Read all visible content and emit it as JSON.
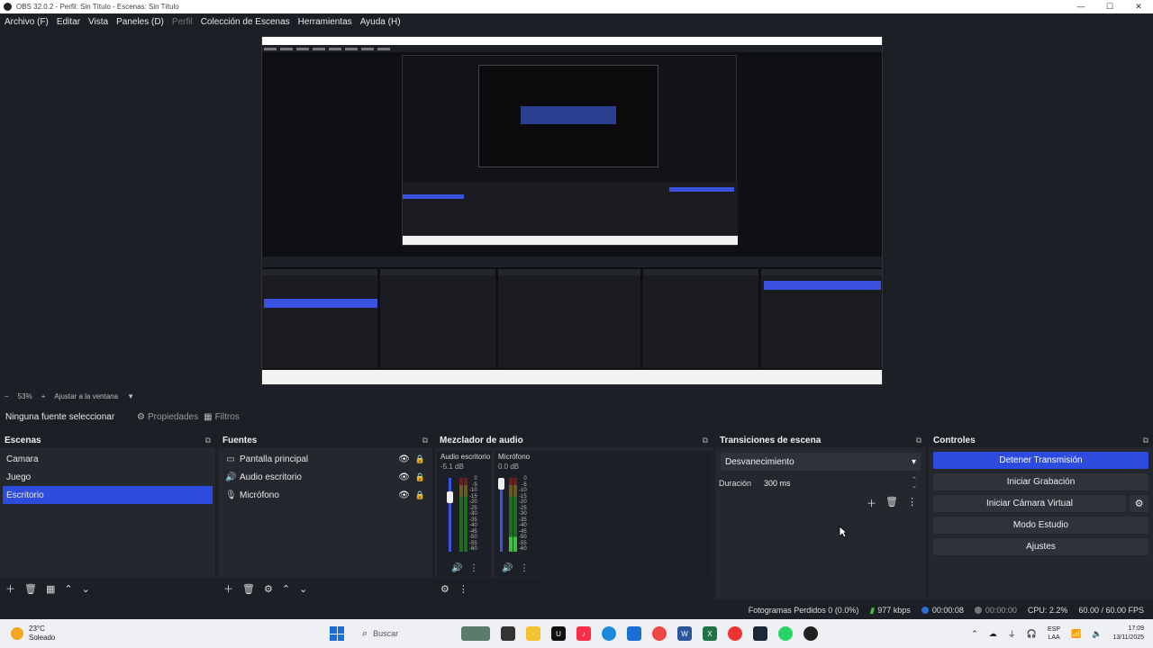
{
  "window": {
    "title": "OBS 32.0.2 - Perfil: Sin Título - Escenas: Sin Título",
    "controls": [
      "—",
      "☐",
      "✕"
    ]
  },
  "menu": {
    "items": [
      {
        "label": "Archivo (F)",
        "disabled": false
      },
      {
        "label": "Editar",
        "disabled": false
      },
      {
        "label": "Vista",
        "disabled": false
      },
      {
        "label": "Paneles (D)",
        "disabled": false
      },
      {
        "label": "Perfil",
        "disabled": true
      },
      {
        "label": "Colección de Escenas",
        "disabled": false
      },
      {
        "label": "Herramientas",
        "disabled": false
      },
      {
        "label": "Ayuda (H)",
        "disabled": false
      }
    ]
  },
  "zoom": {
    "minus": "−",
    "level": "53%",
    "plus": "+",
    "fit": "Ajustar a la ventana"
  },
  "source_toolbar": {
    "no_source": "Ninguna fuente seleccionar",
    "properties": "Propiedades",
    "filters": "Filtros"
  },
  "scenes": {
    "title": "Escenas",
    "items": [
      "Camara",
      "Juego",
      "Escritorio"
    ],
    "selected_index": 2
  },
  "sources": {
    "title": "Fuentes",
    "items": [
      {
        "label": "Pantalla principal",
        "icon": "monitor-icon"
      },
      {
        "label": "Audio escritorio",
        "icon": "speaker-icon"
      },
      {
        "label": "Micrófono",
        "icon": "microphone-icon"
      }
    ]
  },
  "mixer": {
    "title": "Mezclador de audio",
    "channels": [
      {
        "name": "Audio escritorio",
        "db": "-5.1 dB",
        "level": 0.0
      },
      {
        "name": "Micrófono",
        "db": "0.0 dB",
        "level": 0.2
      }
    ],
    "scale": [
      "0",
      "-5",
      "-10",
      "-15",
      "-20",
      "-25",
      "-30",
      "-35",
      "-40",
      "-45",
      "-50",
      "-55",
      "-60"
    ]
  },
  "transitions": {
    "title": "Transiciones de escena",
    "selected": "Desvanecimiento",
    "duration_label": "Duración",
    "duration_value": "300 ms"
  },
  "controls": {
    "title": "Controles",
    "stop_stream": "Detener Transmisión",
    "start_recording": "Iniciar Grabación",
    "start_virtual_cam": "Iniciar Cámara Virtual",
    "studio_mode": "Modo Estudio",
    "settings": "Ajustes"
  },
  "status": {
    "dropped_frames": "Fotogramas Perdidos 0 (0.0%)",
    "bitrate": "977 kbps",
    "stream_time": "00:00:08",
    "rec_time": "00:00:00",
    "cpu": "CPU: 2.2%",
    "fps": "60.00 / 60.00 FPS"
  },
  "taskbar": {
    "temperature": "23°C",
    "weather": "Soleado",
    "search": "Buscar",
    "lang_top": "ESP",
    "lang_bottom": "LAA",
    "time": "17:09",
    "date": "13/11/2025"
  },
  "colors": {
    "accent": "#2d4bdc",
    "panel_bg": "#25272f",
    "window_bg": "#1d1f26"
  }
}
